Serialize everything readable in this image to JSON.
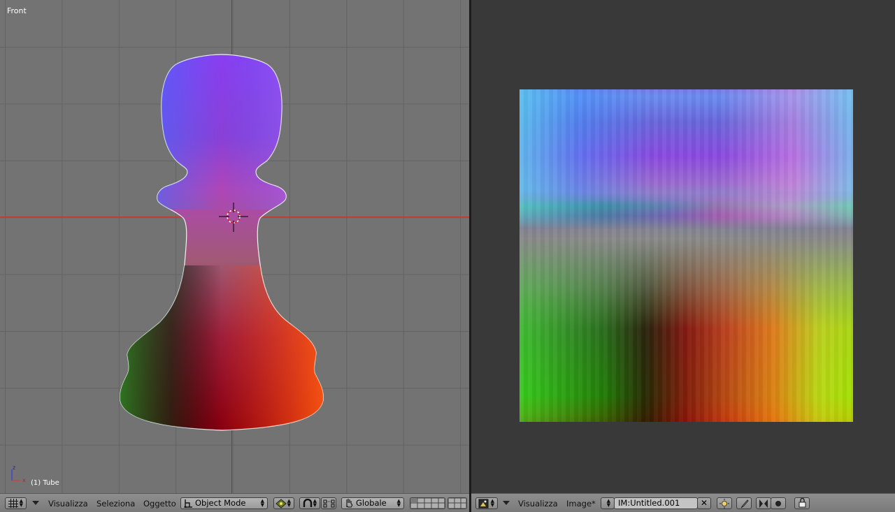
{
  "viewport": {
    "view_name": "Front",
    "active_object": "(1) Tube",
    "gizmo": {
      "z": "z",
      "x": "x"
    }
  },
  "viewport_header": {
    "editor_icon": "grid-icon",
    "menus": [
      "Visualizza",
      "Seleziona",
      "Oggetto"
    ],
    "mode": "Object Mode",
    "pivot_icon": "pivot-point-icon",
    "snap_icon": "magnet-icon",
    "manipulator_icon": "manipulator-icon",
    "transform_orientation": "Globale"
  },
  "image_editor_header": {
    "editor_icon": "image-editor-icon",
    "menus": [
      "Visualizza",
      "Image*"
    ],
    "image_name": "IM:Untitled.001",
    "close_label": "✕"
  },
  "colors": {
    "viewport_bg": "#737373",
    "grid": "#636363",
    "axis_x": "#c03a3a",
    "axis_z": "#4040c8",
    "editor_bg": "#393939",
    "header_bg": "#858585"
  }
}
